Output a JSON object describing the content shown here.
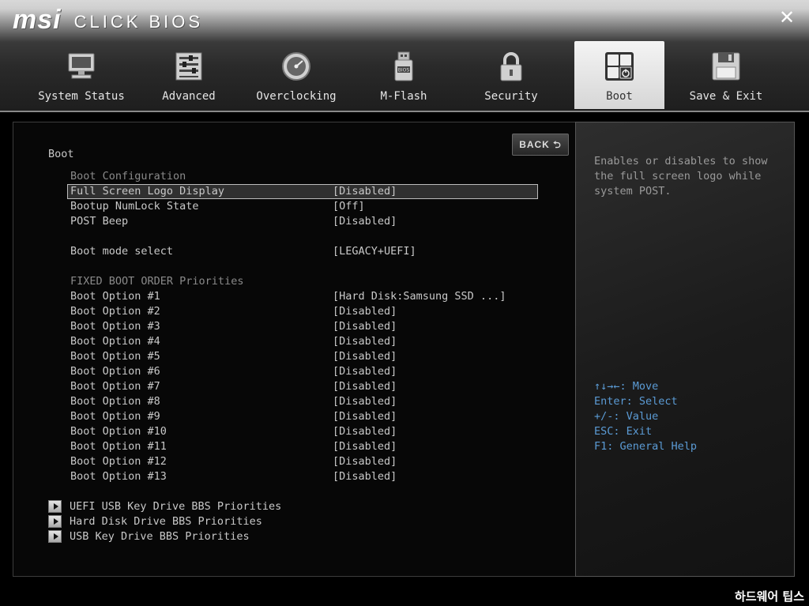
{
  "brand": {
    "logo": "msi",
    "product": "CLICK BIOS"
  },
  "window": {
    "close_label": "✕"
  },
  "tabs": [
    {
      "label": "System Status",
      "icon": "monitor-icon",
      "active": false
    },
    {
      "label": "Advanced",
      "icon": "sliders-icon",
      "active": false
    },
    {
      "label": "Overclocking",
      "icon": "gauge-icon",
      "active": false
    },
    {
      "label": "M-Flash",
      "icon": "usb-drive-icon",
      "active": false
    },
    {
      "label": "Security",
      "icon": "padlock-icon",
      "active": false
    },
    {
      "label": "Boot",
      "icon": "boot-keys-icon",
      "active": true
    },
    {
      "label": "Save & Exit",
      "icon": "floppy-disk-icon",
      "active": false
    }
  ],
  "main": {
    "back_label": "BACK ⮌",
    "title": "Boot",
    "config_header": "Boot Configuration",
    "config_rows": [
      {
        "name": "Full Screen Logo Display",
        "value": "[Disabled]"
      },
      {
        "name": "Bootup NumLock State",
        "value": "[Off]"
      },
      {
        "name": "POST Beep",
        "value": "[Disabled]"
      }
    ],
    "mode_row": {
      "name": "Boot mode select",
      "value": "[LEGACY+UEFI]"
    },
    "fixed_header": "FIXED BOOT ORDER Priorities",
    "boot_options": [
      {
        "name": "Boot Option #1",
        "value": "[Hard Disk:Samsung SSD ...]"
      },
      {
        "name": "Boot Option #2",
        "value": "[Disabled]"
      },
      {
        "name": "Boot Option #3",
        "value": "[Disabled]"
      },
      {
        "name": "Boot Option #4",
        "value": "[Disabled]"
      },
      {
        "name": "Boot Option #5",
        "value": "[Disabled]"
      },
      {
        "name": "Boot Option #6",
        "value": "[Disabled]"
      },
      {
        "name": "Boot Option #7",
        "value": "[Disabled]"
      },
      {
        "name": "Boot Option #8",
        "value": "[Disabled]"
      },
      {
        "name": "Boot Option #9",
        "value": "[Disabled]"
      },
      {
        "name": "Boot Option #10",
        "value": "[Disabled]"
      },
      {
        "name": "Boot Option #11",
        "value": "[Disabled]"
      },
      {
        "name": "Boot Option #12",
        "value": "[Disabled]"
      },
      {
        "name": "Boot Option #13",
        "value": "[Disabled]"
      }
    ],
    "submenus": [
      {
        "name": "UEFI USB Key Drive BBS Priorities"
      },
      {
        "name": "Hard Disk Drive BBS Priorities"
      },
      {
        "name": "USB Key Drive BBS Priorities"
      }
    ]
  },
  "help": {
    "description": [
      "Enables or disables to show",
      "the full screen logo while",
      "system POST."
    ],
    "keys": [
      "↑↓→←: Move",
      "Enter: Select",
      "+/-: Value",
      "ESC: Exit",
      "F1: General Help"
    ]
  },
  "watermark": "하드웨어 팁스",
  "colors": {
    "accent_keys": "#5b9bd5",
    "selected_border": "#bdbdbd"
  }
}
